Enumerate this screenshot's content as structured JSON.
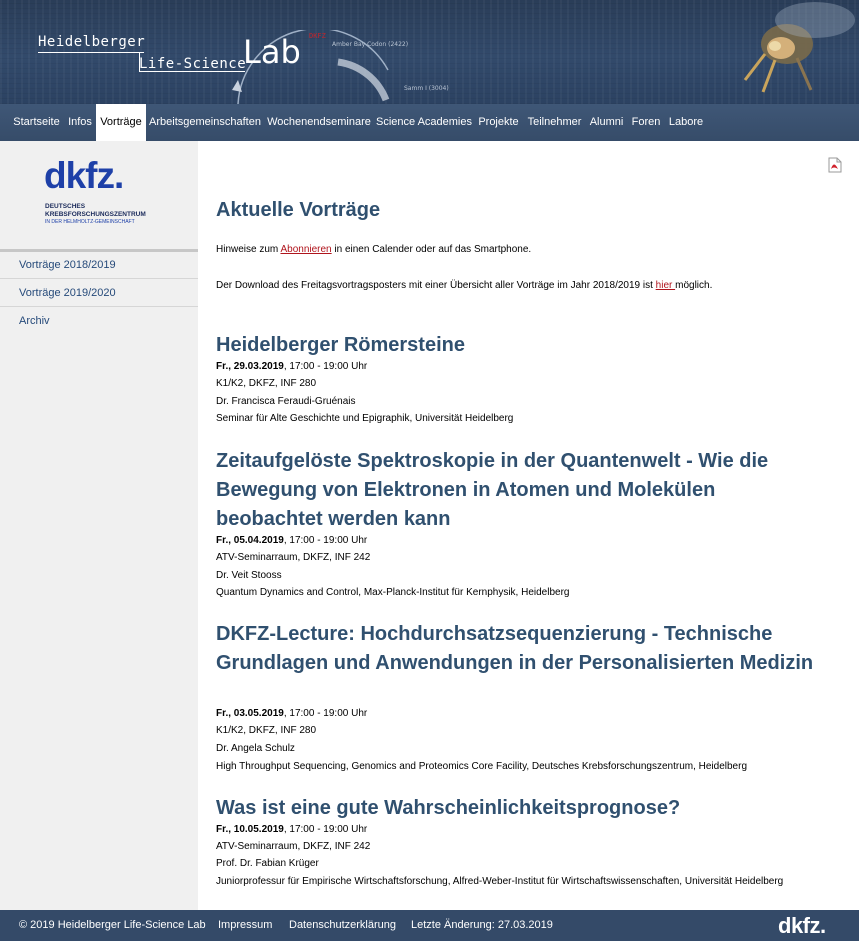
{
  "header": {
    "brand_line1": "Heidelberger",
    "brand_line2": "Life-Science",
    "brand_lab": "Lab",
    "brand_lab_sup": "DKFZ",
    "arc_label1": "Amber Bay Codon (2422)",
    "arc_label2": "Samm I (3004)"
  },
  "nav": {
    "items": [
      {
        "label": "Startseite"
      },
      {
        "label": "Infos"
      },
      {
        "label": "Vorträge"
      },
      {
        "label": "Arbeitsgemeinschaften"
      },
      {
        "label": "Wochenendseminare"
      },
      {
        "label": "Science Academies"
      },
      {
        "label": "Projekte"
      },
      {
        "label": "Teilnehmer"
      },
      {
        "label": "Alumni"
      },
      {
        "label": "Foren"
      },
      {
        "label": "Labore"
      }
    ],
    "active_index": 2
  },
  "sidebar": {
    "logo_word": "dkfz.",
    "logo_line1": "DEUTSCHES",
    "logo_line2": "KREBSFORSCHUNGSZENTRUM",
    "logo_line3": "IN DER HELMHOLTZ-GEMEINSCHAFT",
    "items": [
      {
        "label": "Vorträge 2018/2019"
      },
      {
        "label": "Vorträge 2019/2020"
      },
      {
        "label": "Archiv"
      }
    ]
  },
  "main": {
    "title": "Aktuelle Vorträge",
    "intro1_pre": "Hinweise zum ",
    "intro1_link": "Abonnieren",
    "intro1_post": " in einen Calender oder auf das Smartphone.",
    "intro2_pre": "Der Download des Freitagsvortragsposters mit einer Übersicht aller Vorträge im Jahr 2018/2019 ist ",
    "intro2_link": "hier ",
    "intro2_post": "möglich.",
    "talks": [
      {
        "title": "Heidelberger Römersteine",
        "date": "Fr., 29.03.2019",
        "time": ", 17:00 - 19:00 Uhr",
        "location": "K1/K2, DKFZ, INF 280",
        "speaker": "Dr. Francisca Feraudi-Gruénais",
        "affiliation": "Seminar für Alte Geschichte und Epigraphik, Universität Heidelberg"
      },
      {
        "title": "Zeitaufgelöste Spektroskopie in der Quantenwelt - Wie die Bewegung von Elektronen in Atomen und Molekülen beobachtet werden kann",
        "date": "Fr., 05.04.2019",
        "time": ", 17:00 - 19:00 Uhr",
        "location": "ATV-Seminarraum, DKFZ, INF 242",
        "speaker": "Dr. Veit Stooss",
        "affiliation": "Quantum Dynamics and Control, Max-Planck-Institut für Kernphysik, Heidelberg"
      },
      {
        "title": "DKFZ-Lecture: Hochdurchsatzsequenzierung - Technische Grundlagen und Anwendungen in der Personalisierten Medizin",
        "date": "Fr., 03.05.2019",
        "time": ", 17:00 - 19:00 Uhr",
        "location": "K1/K2, DKFZ, INF 280",
        "speaker": "Dr. Angela Schulz",
        "affiliation": "High Throughput Sequencing, Genomics and Proteomics Core Facility, Deutsches Krebsforschungszentrum, Heidelberg"
      },
      {
        "title": "Was ist eine gute Wahrscheinlichkeitsprognose?",
        "date": "Fr., 10.05.2019",
        "time": ", 17:00 - 19:00 Uhr",
        "location": "ATV-Seminarraum, DKFZ, INF 242",
        "speaker": "Prof. Dr. Fabian Krüger",
        "affiliation": "Juniorprofessur für Empirische Wirtschaftsforschung, Alfred-Weber-Institut für Wirtschaftswissenschaften, Universität Heidelberg"
      }
    ]
  },
  "footer": {
    "copyright": "© 2019 Heidelberger Life-Science Lab",
    "impressum": "Impressum",
    "datenschutz": "Datenschutzerklärung",
    "last_change": "Letzte Änderung: 27.03.2019",
    "logo": "dkfz."
  },
  "colors": {
    "header_bg": "#2f4565",
    "nav_bg": "#3b5270",
    "title_color": "#30506f",
    "link_color": "#b0141c",
    "sidebar_bg": "#f0f0f0",
    "footer_bg": "#344a68",
    "dkfz_blue": "#1e40a8"
  }
}
